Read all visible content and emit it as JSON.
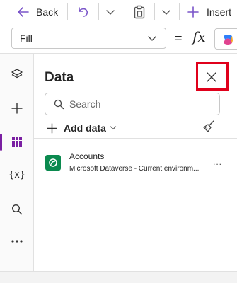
{
  "toolbar": {
    "back_label": "Back",
    "insert_label": "Insert"
  },
  "formula": {
    "property_value": "Fill",
    "equals": "=",
    "fx": "fx"
  },
  "panel": {
    "title": "Data",
    "search_placeholder": "Search",
    "add_data_label": "Add data",
    "items": [
      {
        "name": "Accounts",
        "subtitle": "Microsoft Dataverse - Current environm...",
        "more": "..."
      }
    ]
  },
  "rail": {
    "variables_label": "{x}",
    "more_label": "..."
  },
  "colors": {
    "accent": "#7a55c9",
    "rail_active": "#7a1fa2",
    "highlight": "#e0001b",
    "dataverse": "#0b8a4f"
  }
}
